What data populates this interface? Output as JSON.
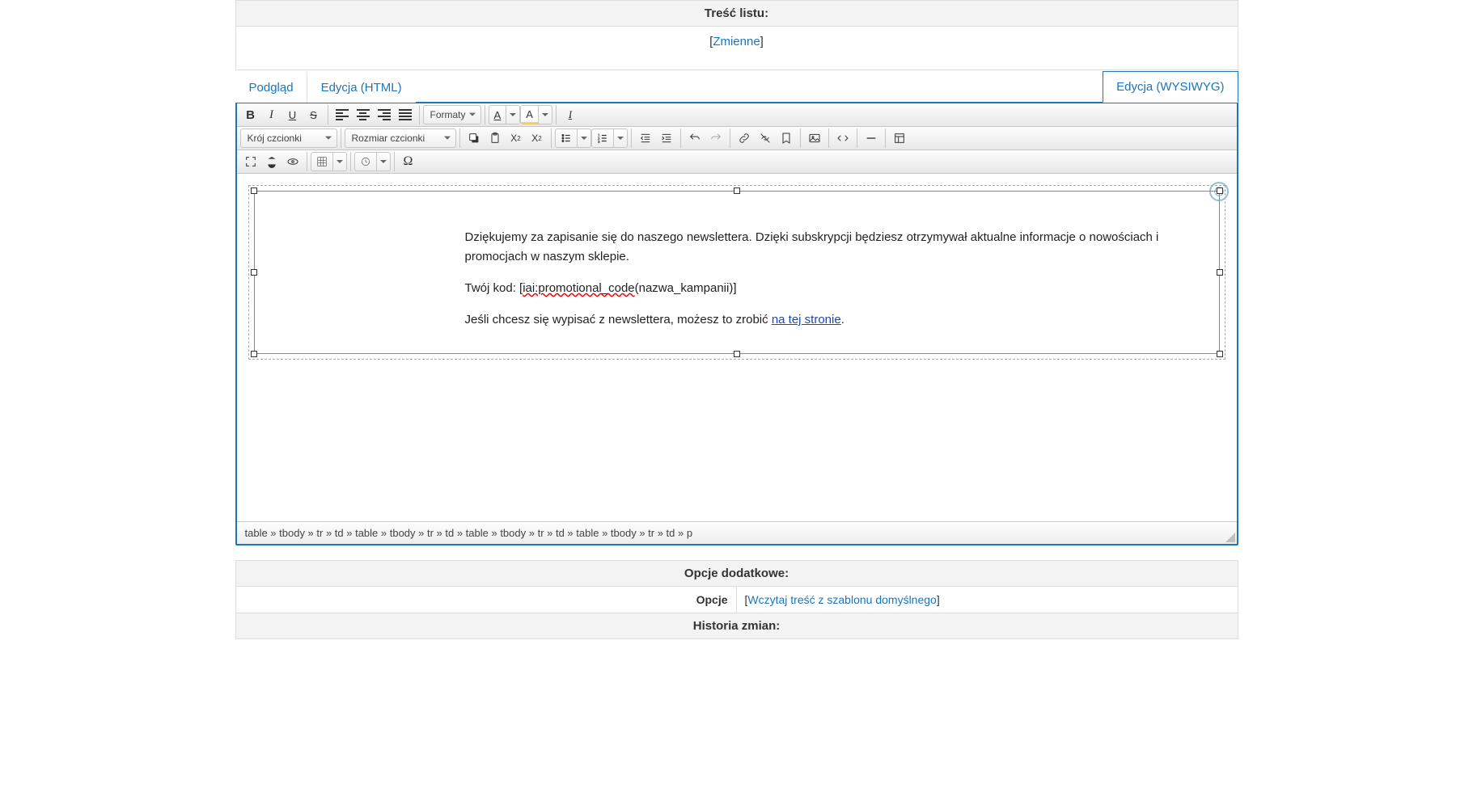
{
  "header": {
    "content_label": "Treść listu:",
    "variables_link": "Zmienne"
  },
  "tabs": {
    "preview": "Podgląd",
    "edit_html": "Edycja (HTML)",
    "edit_wysiwyg": "Edycja (WYSIWYG)"
  },
  "toolbar": {
    "formats": "Formaty",
    "font_family": "Krój czcionki",
    "font_size": "Rozmiar czcionki",
    "text_style_A": "A",
    "omega": "Ω"
  },
  "content": {
    "line1": "Dziękujemy za zapisanie się do naszego newslettera. Dzięki subskrypcji będziesz otrzymywał aktualne informacje o nowościach i promocjach w naszym sklepie.",
    "line2_prefix": "Twój kod: [",
    "line2_spell": "iai:promotional_code",
    "line2_suffix": "(nazwa_kampanii)]",
    "line3_prefix": "Jeśli chcesz się wypisać z newslettera, możesz to zrobić ",
    "line3_link": "na tej stronie",
    "line3_suffix": "."
  },
  "statusbar": {
    "path": "table » tbody » tr » td » table » tbody » tr » td » table » tbody » tr » td » table » tbody » tr » td » p"
  },
  "options": {
    "header": "Opcje dodatkowe:",
    "row_label": "Opcje",
    "row_link": "Wczytaj treść z szablonu domyślnego",
    "history": "Historia zmian:"
  }
}
